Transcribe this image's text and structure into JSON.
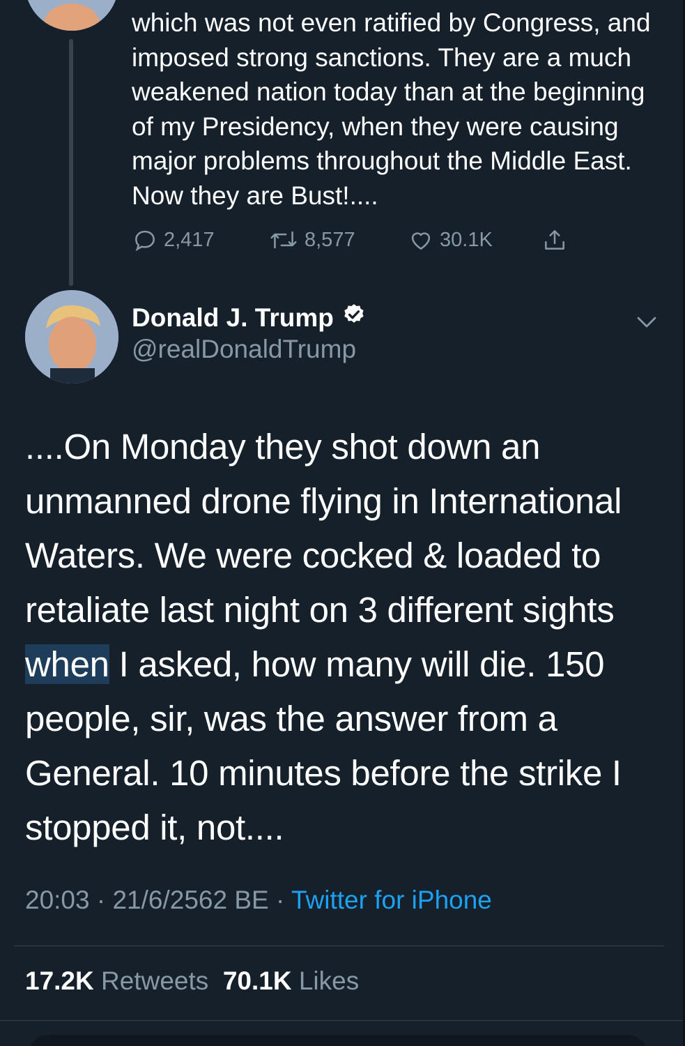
{
  "previous_tweet": {
    "text": "which was not even ratified by Congress, and imposed strong sanctions. They are a much weakened nation today than at the beginning of my Presidency, when they were causing major problems throughout the Middle East. Now they are Bust!....",
    "actions": {
      "replies": "2,417",
      "retweets": "8,577",
      "likes": "30.1K"
    }
  },
  "tweet": {
    "author": {
      "display_name": "Donald J. Trump",
      "handle": "@realDonaldTrump",
      "verified": true
    },
    "text_before_highlight": "....On Monday they shot down an unmanned drone flying in International Waters. We were cocked & loaded to retaliate last night on 3 different sights ",
    "highlighted_word": "when",
    "text_after_highlight": " I asked, how many will die. 150 people, sir, was the answer from a General. 10 minutes before the strike I stopped it, not....",
    "time": "20:03",
    "date": "21/6/2562 BE",
    "separator": "·",
    "source": "Twitter for iPhone",
    "stats": {
      "retweets_count": "17.2K",
      "retweets_label": "Retweets",
      "likes_count": "70.1K",
      "likes_label": "Likes"
    }
  },
  "colors": {
    "background": "#15202b",
    "secondary_text": "#8899a6",
    "link": "#1da1f2",
    "highlight": "#1d3d5a"
  },
  "icons": [
    "reply-icon",
    "retweet-icon",
    "like-icon",
    "share-icon",
    "verified-badge-icon",
    "chevron-down-icon"
  ]
}
